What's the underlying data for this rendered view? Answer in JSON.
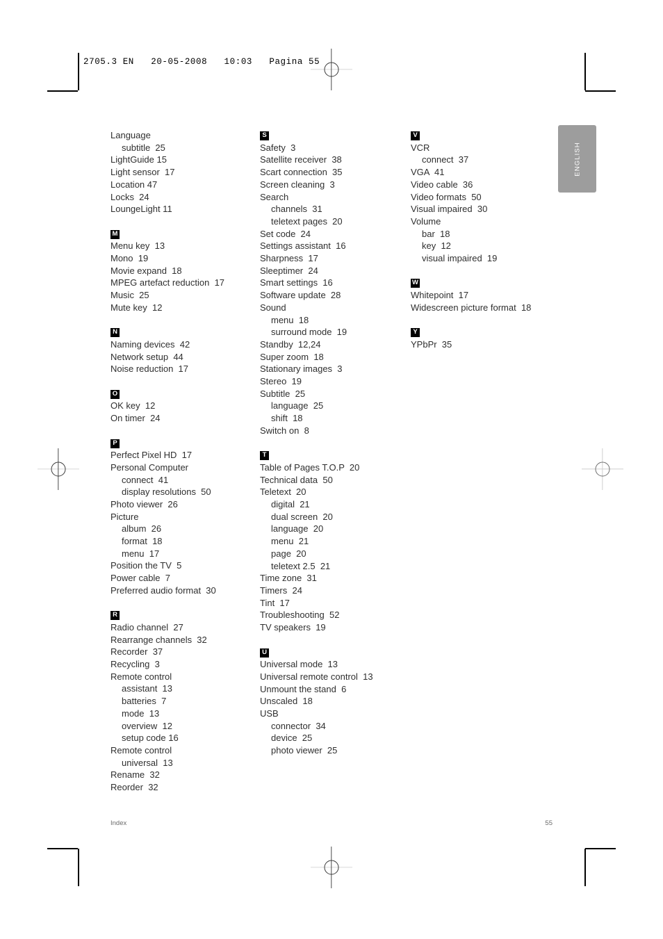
{
  "page": {
    "slug": "2705.3 EN   20-05-2008   10:03   Pagina 55",
    "side_tab_label": "ENGLISH",
    "footer_left": "Index",
    "footer_right": "55"
  },
  "columns": [
    {
      "name": "column-1",
      "sections": [
        {
          "letter": "",
          "entries": [
            {
              "text": "Language",
              "sub": false
            },
            {
              "text": "subtitle  25",
              "sub": true
            },
            {
              "text": "LightGuide 15",
              "sub": false
            },
            {
              "text": "Light sensor  17",
              "sub": false
            },
            {
              "text": "Location 47",
              "sub": false
            },
            {
              "text": "Locks  24",
              "sub": false
            },
            {
              "text": "LoungeLight 11",
              "sub": false
            }
          ]
        },
        {
          "letter": "M",
          "entries": [
            {
              "text": "Menu key  13",
              "sub": false
            },
            {
              "text": "Mono  19",
              "sub": false
            },
            {
              "text": "Movie expand  18",
              "sub": false
            },
            {
              "text": "MPEG artefact reduction  17",
              "sub": false
            },
            {
              "text": "Music  25",
              "sub": false
            },
            {
              "text": "Mute key  12",
              "sub": false
            }
          ]
        },
        {
          "letter": "N",
          "entries": [
            {
              "text": "Naming devices  42",
              "sub": false
            },
            {
              "text": "Network setup  44",
              "sub": false
            },
            {
              "text": "Noise reduction  17",
              "sub": false
            }
          ]
        },
        {
          "letter": "O",
          "entries": [
            {
              "text": "OK key  12",
              "sub": false
            },
            {
              "text": "On timer  24",
              "sub": false
            }
          ]
        },
        {
          "letter": "P",
          "entries": [
            {
              "text": "Perfect Pixel HD  17",
              "sub": false
            },
            {
              "text": "Personal Computer",
              "sub": false
            },
            {
              "text": "connect  41",
              "sub": true
            },
            {
              "text": "display resolutions  50",
              "sub": true
            },
            {
              "text": "Photo viewer  26",
              "sub": false
            },
            {
              "text": "Picture",
              "sub": false
            },
            {
              "text": "album  26",
              "sub": true
            },
            {
              "text": "format  18",
              "sub": true
            },
            {
              "text": "menu  17",
              "sub": true
            },
            {
              "text": "Position the TV  5",
              "sub": false
            },
            {
              "text": "Power cable  7",
              "sub": false
            },
            {
              "text": "Preferred audio format  30",
              "sub": false
            }
          ]
        },
        {
          "letter": "R",
          "entries": [
            {
              "text": "Radio channel  27",
              "sub": false
            },
            {
              "text": "Rearrange channels  32",
              "sub": false
            },
            {
              "text": "Recorder  37",
              "sub": false
            },
            {
              "text": "Recycling  3",
              "sub": false
            },
            {
              "text": "Remote control",
              "sub": false
            },
            {
              "text": "assistant  13",
              "sub": true
            },
            {
              "text": "batteries  7",
              "sub": true
            },
            {
              "text": "mode  13",
              "sub": true
            },
            {
              "text": "overview  12",
              "sub": true
            },
            {
              "text": "setup code 16",
              "sub": true
            },
            {
              "text": "Remote control",
              "sub": false
            },
            {
              "text": "universal  13",
              "sub": true
            },
            {
              "text": "Rename  32",
              "sub": false
            },
            {
              "text": "Reorder  32",
              "sub": false
            }
          ]
        }
      ]
    },
    {
      "name": "column-2",
      "sections": [
        {
          "letter": "S",
          "entries": [
            {
              "text": "Safety  3",
              "sub": false
            },
            {
              "text": "Satellite receiver  38",
              "sub": false
            },
            {
              "text": "Scart connection  35",
              "sub": false
            },
            {
              "text": "Screen cleaning  3",
              "sub": false
            },
            {
              "text": "Search",
              "sub": false
            },
            {
              "text": "channels  31",
              "sub": true
            },
            {
              "text": "teletext pages  20",
              "sub": true
            },
            {
              "text": "Set code  24",
              "sub": false
            },
            {
              "text": "Settings assistant  16",
              "sub": false
            },
            {
              "text": "Sharpness  17",
              "sub": false
            },
            {
              "text": "Sleeptimer  24",
              "sub": false
            },
            {
              "text": "Smart settings  16",
              "sub": false
            },
            {
              "text": "Software update  28",
              "sub": false
            },
            {
              "text": "Sound",
              "sub": false
            },
            {
              "text": "menu  18",
              "sub": true
            },
            {
              "text": "surround mode  19",
              "sub": true
            },
            {
              "text": "Standby  12,24",
              "sub": false
            },
            {
              "text": "Super zoom  18",
              "sub": false
            },
            {
              "text": "Stationary images  3",
              "sub": false
            },
            {
              "text": "Stereo  19",
              "sub": false
            },
            {
              "text": "Subtitle  25",
              "sub": false
            },
            {
              "text": "language  25",
              "sub": true
            },
            {
              "text": "shift  18",
              "sub": true
            },
            {
              "text": "Switch on  8",
              "sub": false
            }
          ]
        },
        {
          "letter": "T",
          "entries": [
            {
              "text": "Table of Pages T.O.P  20",
              "sub": false
            },
            {
              "text": "Technical data  50",
              "sub": false
            },
            {
              "text": "Teletext  20",
              "sub": false
            },
            {
              "text": "digital  21",
              "sub": true
            },
            {
              "text": "dual screen  20",
              "sub": true
            },
            {
              "text": "language  20",
              "sub": true
            },
            {
              "text": "menu  21",
              "sub": true
            },
            {
              "text": "page  20",
              "sub": true
            },
            {
              "text": "teletext 2.5  21",
              "sub": true
            },
            {
              "text": "Time zone  31",
              "sub": false
            },
            {
              "text": "Timers  24",
              "sub": false
            },
            {
              "text": "Tint  17",
              "sub": false
            },
            {
              "text": "Troubleshooting  52",
              "sub": false
            },
            {
              "text": "TV speakers  19",
              "sub": false
            }
          ]
        },
        {
          "letter": "U",
          "entries": [
            {
              "text": "Universal mode  13",
              "sub": false
            },
            {
              "text": "Universal remote control  13",
              "sub": false
            },
            {
              "text": "Unmount the stand  6",
              "sub": false
            },
            {
              "text": "Unscaled  18",
              "sub": false
            },
            {
              "text": "USB",
              "sub": false
            },
            {
              "text": "connector  34",
              "sub": true
            },
            {
              "text": "device  25",
              "sub": true
            },
            {
              "text": "photo viewer  25",
              "sub": true
            }
          ]
        }
      ]
    },
    {
      "name": "column-3",
      "sections": [
        {
          "letter": "V",
          "entries": [
            {
              "text": "VCR",
              "sub": false
            },
            {
              "text": "connect  37",
              "sub": true
            },
            {
              "text": "VGA  41",
              "sub": false
            },
            {
              "text": "Video cable  36",
              "sub": false
            },
            {
              "text": "Video formats  50",
              "sub": false
            },
            {
              "text": "Visual impaired  30",
              "sub": false
            },
            {
              "text": "Volume",
              "sub": false
            },
            {
              "text": "bar  18",
              "sub": true
            },
            {
              "text": "key  12",
              "sub": true
            },
            {
              "text": "visual impaired  19",
              "sub": true
            }
          ]
        },
        {
          "letter": "W",
          "entries": [
            {
              "text": "Whitepoint  17",
              "sub": false
            },
            {
              "text": "Widescreen picture format  18",
              "sub": false
            }
          ]
        },
        {
          "letter": "Y",
          "entries": [
            {
              "text": "YPbPr  35",
              "sub": false
            }
          ]
        }
      ]
    }
  ]
}
